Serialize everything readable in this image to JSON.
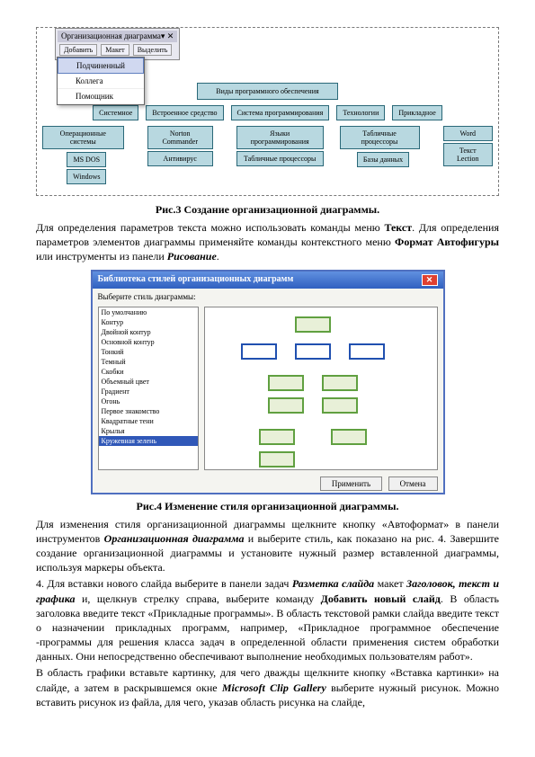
{
  "fig3": {
    "toolbar_title": "Организационная диаграмма",
    "toolbar_btns": [
      "Добавить",
      "Макет",
      "Выделить"
    ],
    "dropdown": [
      "Подчиненный",
      "Коллега",
      "Помощник"
    ],
    "root": "Виды программного обеспечения",
    "level2": [
      "Системное",
      "Встроенное средство",
      "Система программирования",
      "Технологии",
      "Прикладное"
    ],
    "grp1_head": "Операционные системы",
    "grp1": [
      "MS DOS",
      "Windows"
    ],
    "grp2": [
      "Norton Commander",
      "Антивирус"
    ],
    "grp3": [
      "Языки программирования",
      "Табличные процессоры"
    ],
    "grp4_head": "Табличные процессоры",
    "grp4": [
      "Базы данных"
    ],
    "grp5": [
      "Word",
      "Текст Lection"
    ]
  },
  "caption3": "Рис.3 Создание организационной диаграммы.",
  "para1_a": "Для определения параметров текста можно использовать команды меню ",
  "para1_b": "Текст",
  "para1_c": ". Для определения параметров элементов диаграммы применяйте команды контекстного меню ",
  "para1_d": "Формат Автофигуры",
  "para1_e": " или инструменты из панели ",
  "para1_f": "Рисование",
  "para1_g": ".",
  "dialog": {
    "title": "Библиотека стилей организационных диаграмм",
    "label": "Выберите стиль диаграммы:",
    "styles": [
      "По умолчанию",
      "Контур",
      "Двойной контур",
      "Основной контур",
      "Тонкий",
      "Темный",
      "Скобки",
      "Объемный цвет",
      "Градиент",
      "Огонь",
      "Первое знакомство",
      "Квадратные тени",
      "Крылья",
      "Кружевная зелень"
    ],
    "selected_index": 13,
    "btn_ok": "Применить",
    "btn_cancel": "Отмена"
  },
  "caption4": "Рис.4 Изменение стиля организационной диаграммы.",
  "para2_a": "Для изменения стиля организационной диаграммы щелкните кнопку «Автоформат» в панели инструментов ",
  "para2_b": "Организационная диаграмма",
  "para2_c": " и выберите стиль, как показано на рис. 4. Завершите создание организационной диаграммы и установите нужный размер вставленной диаграммы, используя маркеры объекта.",
  "para3_a": "4. Для вставки нового слайда выберите в панели задач ",
  "para3_b": "Разметка слайда",
  "para3_c": " макет ",
  "para3_d": "Заголовок, текст и графика",
  "para3_e": " и, щелкнув стрелку справа, выберите команду ",
  "para3_f": "Добавить новый слайд",
  "para3_g": ". В область заголовка введите текст «Прикладные программы». В область текстовой рамки слайда введите текст о назначении прикладных программ, например, «Прикладное программное обеспечение -программы для решения класса задач в определенной области применения систем обработки данных. Они непосредственно обеспечивают выполнение необходимых пользователям работ».",
  "para4_a": "В область графики вставьте картинку, для чего дважды щелкните кнопку «Вставка картинки» на слайде, а затем в раскрывшемся окне ",
  "para4_b": "Microsoft Clip Gallery",
  "para4_c": " выберите нужный рисунок. Можно вставить рисунок из файла, для чего, указав область рисунка на слайде,"
}
